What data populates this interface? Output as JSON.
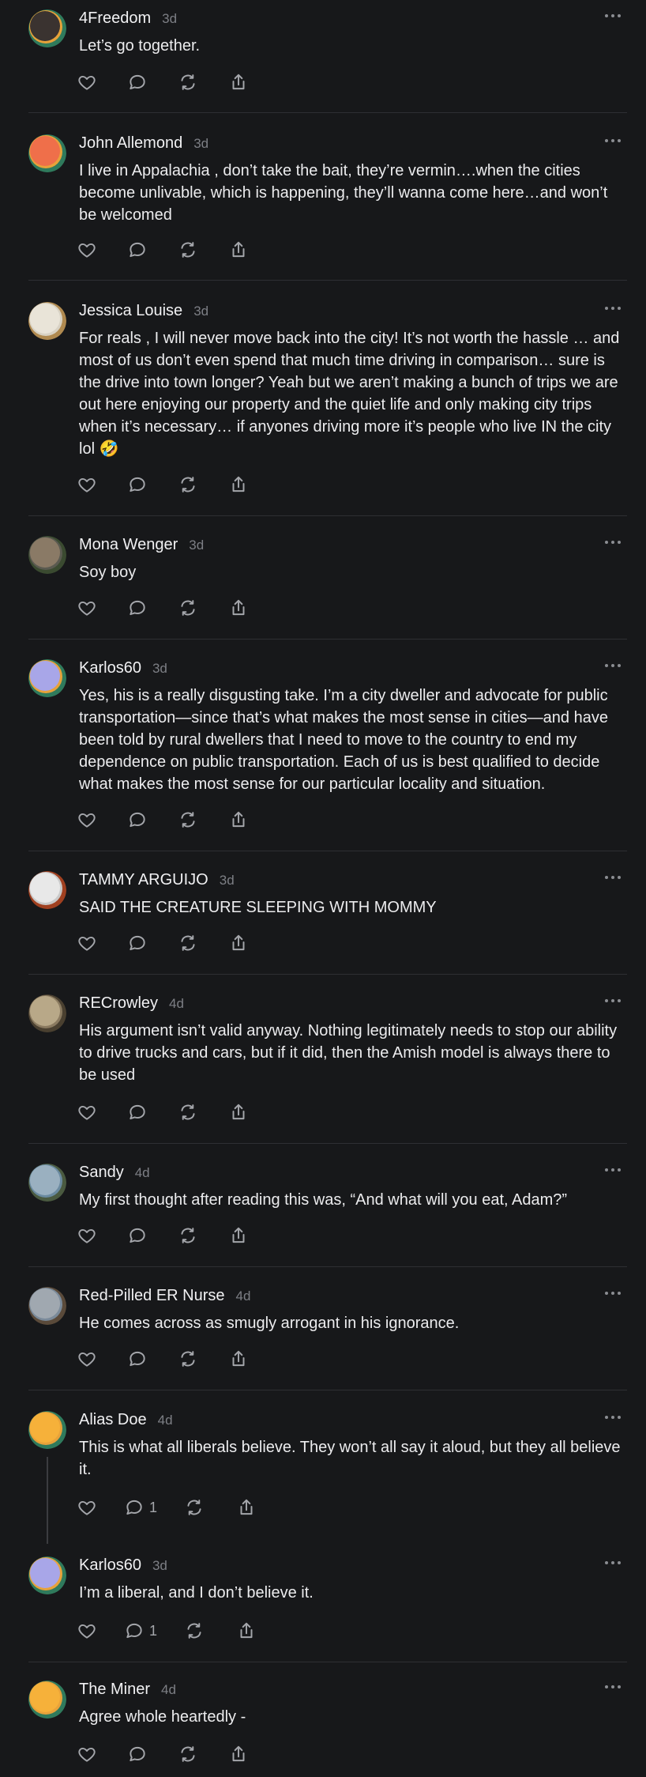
{
  "comments": [
    {
      "name": "4Freedom",
      "time": "3d",
      "text": "Let’s go together.",
      "avatar": {
        "ring": "#e8a23a",
        "fill": "#3a3330",
        "accent": "#2f7a5c"
      },
      "reply_count": ""
    },
    {
      "name": "John Allemond",
      "time": "3d",
      "text": "I live in Appalachia , don’t take the bait, they’re vermin….when the cities become unlivable, which is happening, they’ll wanna come here…and won’t be welcomed",
      "avatar": {
        "ring": "#e8a23a",
        "fill": "#ef6f4a",
        "accent": "#2f7a5c"
      },
      "reply_count": ""
    },
    {
      "name": "Jessica Louise",
      "time": "3d",
      "text": "For reals , I will never move back into the city! It’s not worth the hassle … and most of us don’t even spend that much time driving in comparison… sure is the drive into town longer? Yeah but we aren’t making a bunch of trips we are out here enjoying our property and the quiet life and only making city trips when it’s necessary… if anyones driving more it’s people who live IN the city lol 🤣",
      "avatar": {
        "ring": "#d8d2c4",
        "fill": "#e9e4d8",
        "accent": "#b08a50"
      },
      "reply_count": ""
    },
    {
      "name": "Mona Wenger",
      "time": "3d",
      "text": "Soy boy",
      "avatar": {
        "ring": "#5a5a50",
        "fill": "#8a7a66",
        "accent": "#3a4a30"
      },
      "reply_count": ""
    },
    {
      "name": "Karlos60",
      "time": "3d",
      "text": "Yes, his is a really disgusting take. I’m a city dweller and advocate for public transportation—since that’s what makes the most sense in cities—and have been told by rural dwellers that I need to move to the country to end my dependence on public transportation. Each of us is best qualified to decide what makes the most sense for our particular locality and situation.",
      "avatar": {
        "ring": "#e8a23a",
        "fill": "#a8a6e8",
        "accent": "#2f7a5c"
      },
      "reply_count": ""
    },
    {
      "name": "TAMMY ARGUIJO",
      "time": "3d",
      "text": "SAID THE CREATURE SLEEPING WITH MOMMY",
      "avatar": {
        "ring": "#c9c9c9",
        "fill": "#e8e8e8",
        "accent": "#a04020"
      },
      "reply_count": ""
    },
    {
      "name": "RECrowley",
      "time": "4d",
      "text": "His argument isn’t valid anyway. Nothing legitimately needs to stop our ability to drive trucks and cars, but if it did, then the Amish model is always there to be used",
      "avatar": {
        "ring": "#8a7a60",
        "fill": "#b8a888",
        "accent": "#4a4030"
      },
      "reply_count": ""
    },
    {
      "name": "Sandy",
      "time": "4d",
      "text": "My first thought after reading this was, “And what will you eat, Adam?”",
      "avatar": {
        "ring": "#6a8aa0",
        "fill": "#9ab0c0",
        "accent": "#4a5a40"
      },
      "reply_count": ""
    },
    {
      "name": "Red-Pilled ER Nurse",
      "time": "4d",
      "text": "He comes across as smugly arrogant in his ignorance.",
      "avatar": {
        "ring": "#7a8a9a",
        "fill": "#a0a8b0",
        "accent": "#5a4a3a"
      },
      "reply_count": ""
    },
    {
      "name": "Alias Doe",
      "time": "4d",
      "text": "This is what all liberals believe. They won’t all say it aloud, but they all believe it.",
      "avatar": {
        "ring": "#e8a23a",
        "fill": "#f6b13a",
        "accent": "#2f7a5c"
      },
      "reply_count": "1"
    },
    {
      "name": "Karlos60",
      "time": "3d",
      "text": "I’m a liberal, and I don’t believe it.",
      "avatar": {
        "ring": "#e8a23a",
        "fill": "#a8a6e8",
        "accent": "#2f7a5c"
      },
      "reply_count": "1"
    },
    {
      "name": "The Miner",
      "time": "4d",
      "text": "Agree whole heartedly -",
      "avatar": {
        "ring": "#e8a23a",
        "fill": "#f6b13a",
        "accent": "#2f7a5c"
      },
      "reply_count": ""
    }
  ]
}
